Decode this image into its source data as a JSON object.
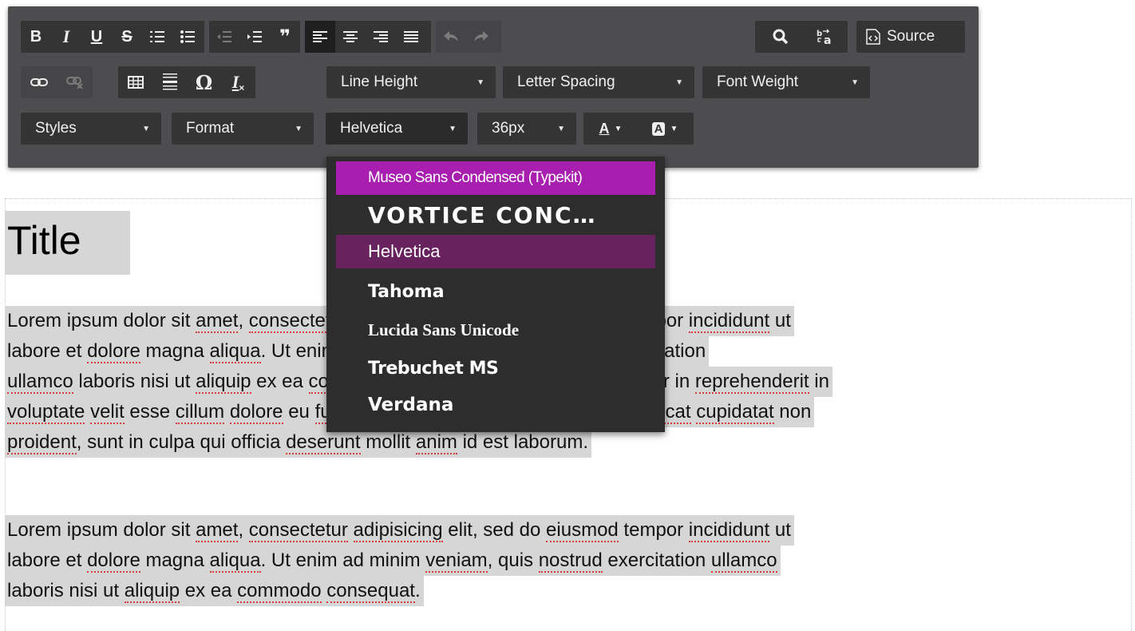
{
  "toolbar": {
    "source_label": "Source",
    "line_height_label": "Line Height",
    "letter_spacing_label": "Letter Spacing",
    "font_weight_label": "Font Weight",
    "styles_label": "Styles",
    "format_label": "Format",
    "font_label": "Helvetica",
    "size_label": "36px",
    "bold_glyph": "B",
    "italic_glyph": "I",
    "underline_glyph": "U",
    "strike_glyph": "S",
    "blockquote_glyph": "❞",
    "omega_glyph": "Ω",
    "text_color_glyph": "A",
    "bg_color_glyph": "A",
    "remove_format_glyph": "I"
  },
  "font_menu": {
    "items": [
      {
        "label": "Museo Sans Condensed (Typekit)",
        "state": "hover"
      },
      {
        "label": "VORTICE CONC…",
        "state": "normal"
      },
      {
        "label": "Helvetica",
        "state": "selected"
      },
      {
        "label": "Tahoma",
        "state": "normal"
      },
      {
        "label": "Lucida Sans Unicode",
        "state": "normal"
      },
      {
        "label": "Trebuchet MS",
        "state": "normal"
      },
      {
        "label": "Verdana",
        "state": "normal"
      }
    ]
  },
  "content": {
    "title": "Title",
    "paragraph1": [
      "Lorem ipsum dolor sit amet, consectetur adipisicing elit, sed do eiusmod tempor incididunt ut",
      "labore et dolore magna aliqua. Ut enim ad minim veniam, quis nostrud exercitation",
      "ullamco laboris nisi ut aliquip ex ea commodo consequat. Duis aute irure dolor in reprehenderit in",
      "voluptate velit esse cillum dolore eu fugiat nulla pariatur. Excepteur sint occaecat cupidatat non",
      "proident, sunt in culpa qui officia deserunt mollit anim id est laborum."
    ],
    "paragraph2": [
      "Lorem ipsum dolor sit amet, consectetur adipisicing elit, sed do eiusmod tempor incididunt ut",
      "labore et dolore magna aliqua. Ut enim ad minim veniam, quis nostrud exercitation ullamco",
      "laboris nisi ut aliquip ex ea commodo consequat."
    ]
  },
  "colors": {
    "toolbar_bg": "#4d4d4f",
    "button_bg": "#343434",
    "menu_bg": "#2d2d2d",
    "menu_hover": "#a81fb0",
    "menu_selected": "#68235e",
    "selection_highlight": "#d6d6d6",
    "spellcheck_underline": "#d43b3b"
  }
}
